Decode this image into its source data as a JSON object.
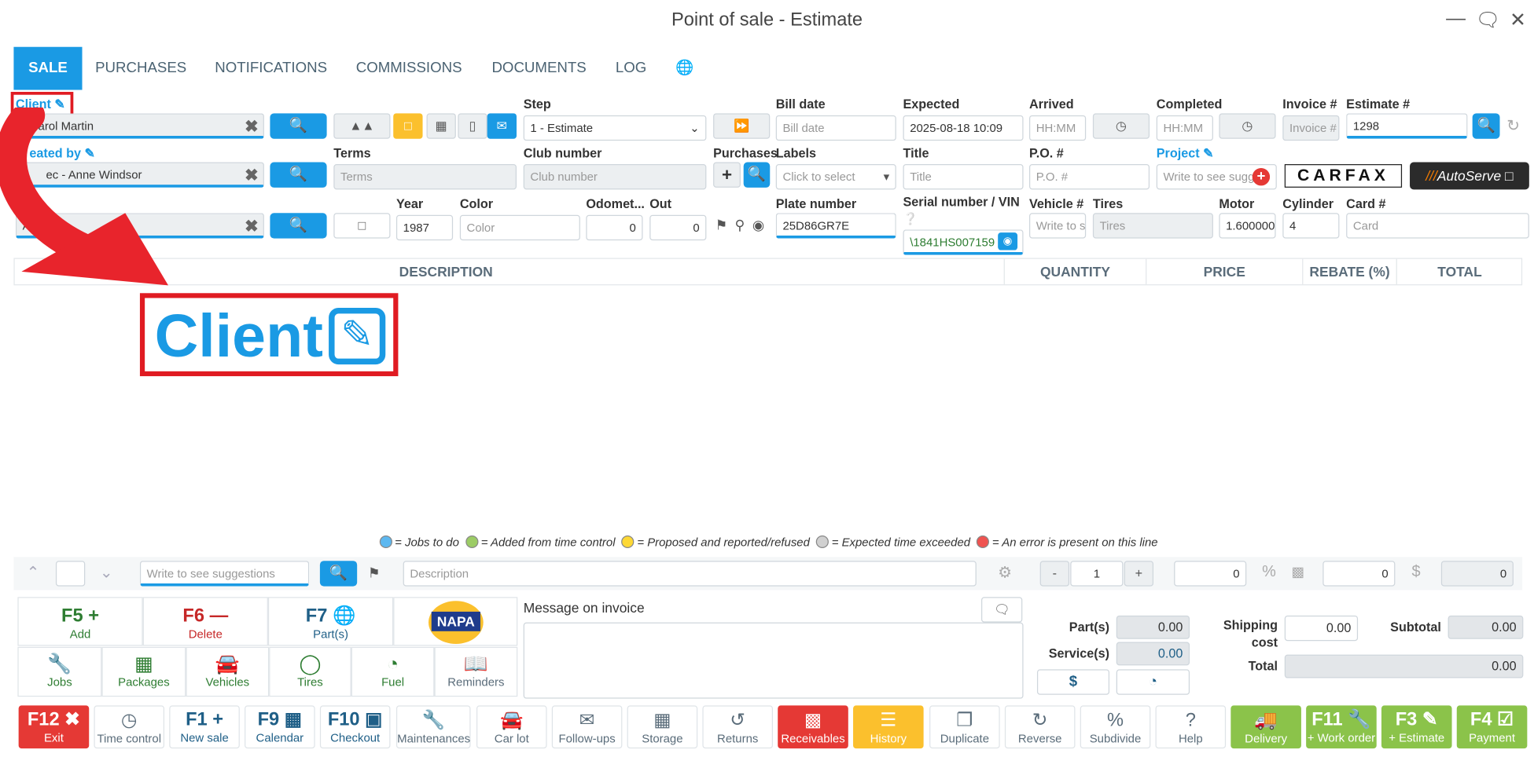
{
  "window": {
    "title": "Point of sale - Estimate"
  },
  "tabs": [
    "SALE",
    "PURCHASES",
    "NOTIFICATIONS",
    "COMMISSIONS",
    "DOCUMENTS",
    "LOG"
  ],
  "header": {
    "client_label": "Client",
    "client_value": "- Carol Martin",
    "created_by_label": "eated by",
    "created_by_value": "ec - Anne Windsor",
    "vehicle_value": "A",
    "step_label": "Step",
    "step_value": "1 - Estimate",
    "terms_label": "Terms",
    "terms_placeholder": "Terms",
    "club_label": "Club number",
    "club_placeholder": "Club number",
    "purchases_label": "Purchases",
    "labels_label": "Labels",
    "labels_value": "Click to select",
    "bill_date_label": "Bill date",
    "bill_date_placeholder": "Bill date",
    "expected_label": "Expected",
    "expected_value": "2025-08-18 10:09",
    "arrived_label": "Arrived",
    "arrived_placeholder": "HH:MM",
    "completed_label": "Completed",
    "completed_placeholder": "HH:MM",
    "invoice_label": "Invoice #",
    "invoice_placeholder": "Invoice #",
    "estimate_label": "Estimate #",
    "estimate_value": "1298",
    "title_label": "Title",
    "title_placeholder": "Title",
    "po_label": "P.O. #",
    "po_placeholder": "P.O. #",
    "project_label": "Project",
    "project_placeholder": "Write to see sugg",
    "carfax_text": "CARFAX",
    "autoserve_text": "AutoServe",
    "year_label": "Year",
    "year_value": "1987",
    "color_label": "Color",
    "color_placeholder": "Color",
    "odometer_label": "Odomet...",
    "odometer_value": "0",
    "out_label": "Out",
    "out_value": "0",
    "plate_label": "Plate number",
    "plate_value": "25D86GR7E",
    "vin_label": "Serial number / VIN",
    "vin_value": "\\1841HS007159",
    "vehicle_num_label": "Vehicle #",
    "vehicle_num_placeholder": "Write to s",
    "tires_label": "Tires",
    "tires_placeholder": "Tires",
    "motor_label": "Motor",
    "motor_value": "1.600000",
    "cylinder_label": "Cylinder",
    "cylinder_value": "4",
    "card_label": "Card #",
    "card_placeholder": "Card"
  },
  "table": {
    "columns": [
      "DESCRIPTION",
      "QUANTITY",
      "PRICE",
      "REBATE (%)",
      "TOTAL"
    ]
  },
  "callout": {
    "text": "Client"
  },
  "legend": [
    {
      "color": "#5db8f0",
      "text": "= Jobs to do"
    },
    {
      "color": "#9ccc65",
      "text": "= Added from time control"
    },
    {
      "color": "#fdd835",
      "text": "= Proposed and reported/refused"
    },
    {
      "color": "#d0d0d0",
      "text": "= Expected time exceeded"
    },
    {
      "color": "#ef5350",
      "text": "= An error is present on this line"
    }
  ],
  "line_entry": {
    "suggest_placeholder": "Write to see suggestions",
    "desc_placeholder": "Description",
    "qty_minus": "-",
    "qty_value": "1",
    "qty_plus": "+",
    "rebate_value": "0",
    "pct_symbol": "%",
    "price_value": "0",
    "dollar_symbol": "$",
    "total_value": "0"
  },
  "quick": [
    {
      "key": "F5",
      "label": "Add"
    },
    {
      "key": "F6",
      "label": "Delete"
    },
    {
      "key": "F7",
      "label": "Part(s)"
    }
  ],
  "napa_text": "NAPA",
  "categories": [
    "Jobs",
    "Packages",
    "Vehicles",
    "Tires",
    "Fuel",
    "Reminders"
  ],
  "message": {
    "label": "Message on invoice"
  },
  "totals": {
    "parts_label": "Part(s)",
    "parts_value": "0.00",
    "services_label": "Service(s)",
    "services_value": "0.00",
    "dollar_button": "$",
    "shipping_label": "Shipping cost",
    "shipping_value": "0.00",
    "subtotal_label": "Subtotal",
    "subtotal_value": "0.00",
    "total_label": "Total",
    "total_value": "0.00"
  },
  "footer": [
    {
      "key": "F12",
      "label": "Exit",
      "style": "red"
    },
    {
      "key": "",
      "label": "Time control",
      "style": "gray"
    },
    {
      "key": "F1",
      "label": "New sale",
      "style": ""
    },
    {
      "key": "F9",
      "label": "Calendar",
      "style": ""
    },
    {
      "key": "F10",
      "label": "Checkout",
      "style": ""
    },
    {
      "key": "",
      "label": "Maintenances",
      "style": "gray"
    },
    {
      "key": "",
      "label": "Car lot",
      "style": "gray"
    },
    {
      "key": "",
      "label": "Follow-ups",
      "style": "gray"
    },
    {
      "key": "",
      "label": "Storage",
      "style": "gray"
    },
    {
      "key": "",
      "label": "Returns",
      "style": "gray"
    },
    {
      "key": "",
      "label": "Receivables",
      "style": "red"
    },
    {
      "key": "",
      "label": "History",
      "style": "yel"
    },
    {
      "key": "",
      "label": "Duplicate",
      "style": "gray"
    },
    {
      "key": "",
      "label": "Reverse",
      "style": "gray"
    },
    {
      "key": "",
      "label": "Subdivide",
      "style": "gray"
    },
    {
      "key": "",
      "label": "Help",
      "style": "gray"
    },
    {
      "key": "",
      "label": "Delivery",
      "style": "grn"
    },
    {
      "key": "F11",
      "label": "+ Work order",
      "style": "grn"
    },
    {
      "key": "F3",
      "label": "+ Estimate",
      "style": "grn"
    },
    {
      "key": "F4",
      "label": "Payment",
      "style": "grn"
    }
  ]
}
